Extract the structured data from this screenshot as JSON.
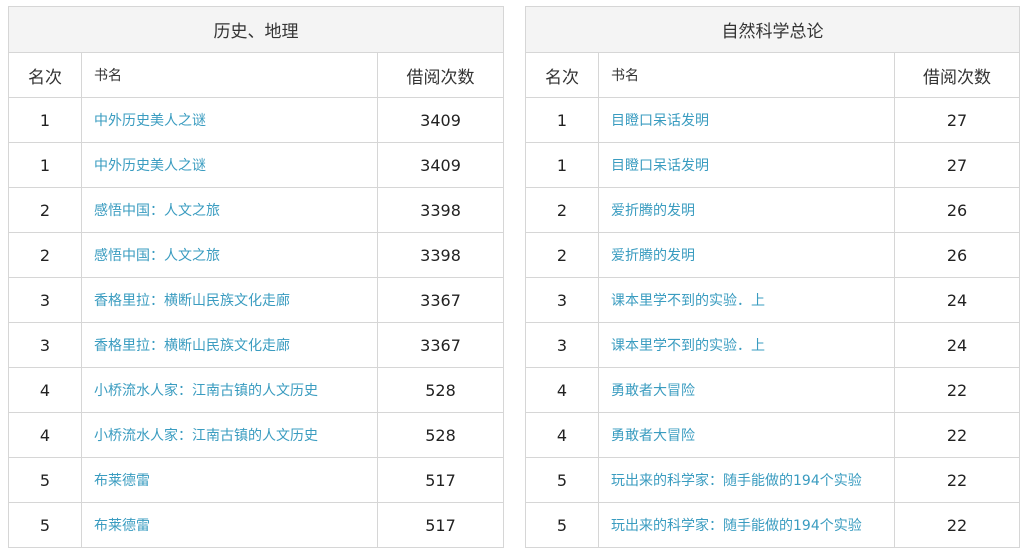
{
  "tables": [
    {
      "title": "历史、地理",
      "headers": {
        "rank": "名次",
        "name": "书名",
        "count": "借阅次数"
      },
      "rows": [
        {
          "rank": "1",
          "name": "中外历史美人之谜",
          "count": "3409"
        },
        {
          "rank": "1",
          "name": "中外历史美人之谜",
          "count": "3409"
        },
        {
          "rank": "2",
          "name": "感悟中国：人文之旅",
          "count": "3398"
        },
        {
          "rank": "2",
          "name": "感悟中国：人文之旅",
          "count": "3398"
        },
        {
          "rank": "3",
          "name": "香格里拉：横断山民族文化走廊",
          "count": "3367"
        },
        {
          "rank": "3",
          "name": "香格里拉：横断山民族文化走廊",
          "count": "3367"
        },
        {
          "rank": "4",
          "name": "小桥流水人家：江南古镇的人文历史",
          "count": "528"
        },
        {
          "rank": "4",
          "name": "小桥流水人家：江南古镇的人文历史",
          "count": "528"
        },
        {
          "rank": "5",
          "name": "布莱德雷",
          "count": "517"
        },
        {
          "rank": "5",
          "name": "布莱德雷",
          "count": "517"
        }
      ]
    },
    {
      "title": "自然科学总论",
      "headers": {
        "rank": "名次",
        "name": "书名",
        "count": "借阅次数"
      },
      "rows": [
        {
          "rank": "1",
          "name": "目瞪口呆话发明",
          "count": "27"
        },
        {
          "rank": "1",
          "name": "目瞪口呆话发明",
          "count": "27"
        },
        {
          "rank": "2",
          "name": "爱折腾的发明",
          "count": "26"
        },
        {
          "rank": "2",
          "name": "爱折腾的发明",
          "count": "26"
        },
        {
          "rank": "3",
          "name": "课本里学不到的实验．上",
          "count": "24"
        },
        {
          "rank": "3",
          "name": "课本里学不到的实验．上",
          "count": "24"
        },
        {
          "rank": "4",
          "name": "勇敢者大冒险",
          "count": "22"
        },
        {
          "rank": "4",
          "name": "勇敢者大冒险",
          "count": "22"
        },
        {
          "rank": "5",
          "name": "玩出来的科学家：随手能做的194个实验",
          "count": "22"
        },
        {
          "rank": "5",
          "name": "玩出来的科学家：随手能做的194个实验",
          "count": "22"
        }
      ]
    }
  ]
}
